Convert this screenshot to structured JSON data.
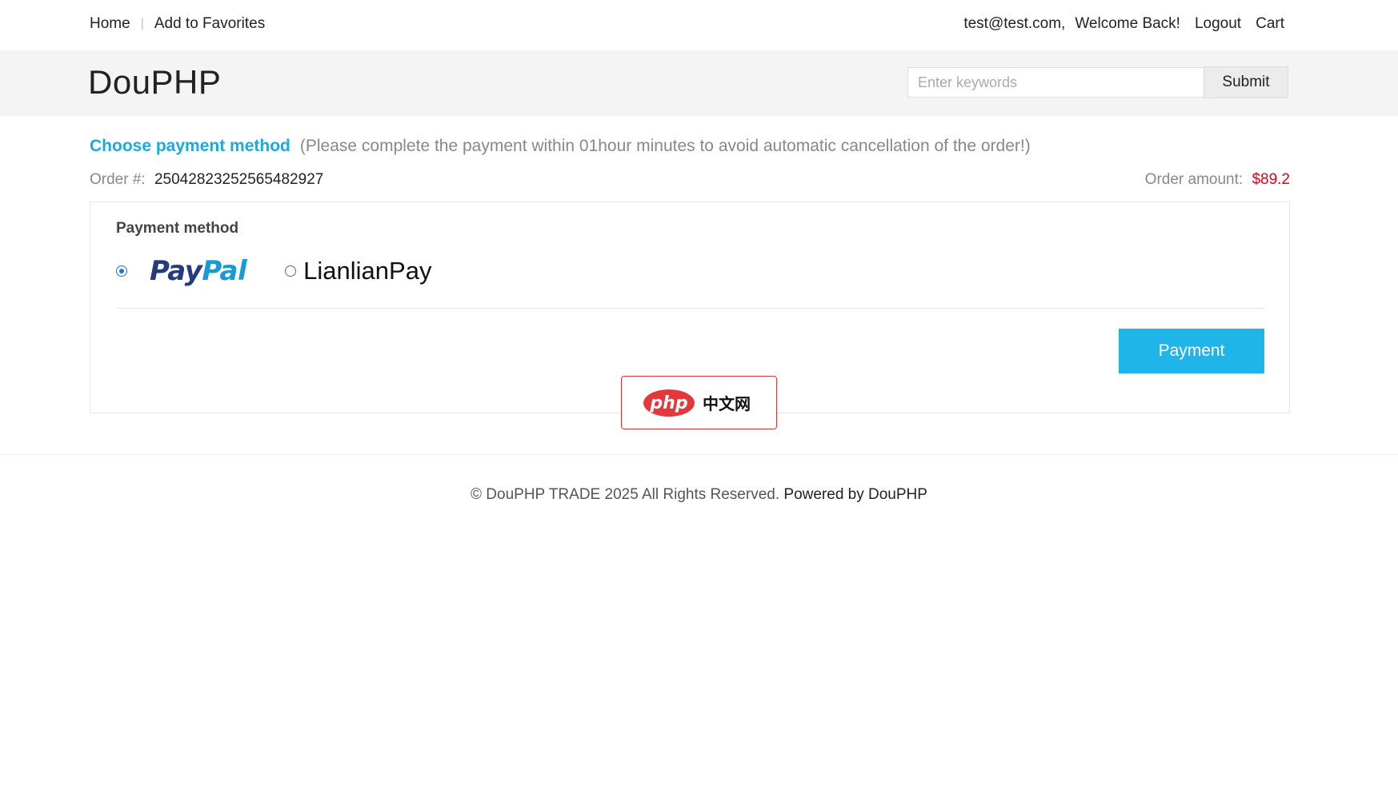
{
  "topnav": {
    "home": "Home",
    "favorites": "Add to Favorites",
    "user_email": "test@test.com,",
    "welcome": "Welcome Back!",
    "logout": "Logout",
    "cart": "Cart"
  },
  "header": {
    "logo": "DouPHP",
    "search_placeholder": "Enter keywords",
    "submit": "Submit"
  },
  "main": {
    "title": "Choose payment method",
    "note": "(Please complete the payment within 01hour minutes to avoid automatic cancellation of the order!)",
    "order_label": "Order #:",
    "order_number": "25042823252565482927",
    "amount_label": "Order amount:",
    "amount_value": "$89.2",
    "payment_method_title": "Payment method",
    "options": [
      {
        "label_part1": "Pay",
        "label_part2": "Pal",
        "selected": true
      },
      {
        "label": "LianlianPay",
        "selected": false
      }
    ],
    "payment_button": "Payment"
  },
  "watermark": {
    "text": "中文网",
    "logo_text": "php"
  },
  "footer": {
    "copyright": "© DouPHP TRADE 2025 All Rights Reserved.",
    "powered": "Powered by DouPHP"
  },
  "colors": {
    "accent": "#1aabde",
    "button": "#1fb5e8",
    "price": "#e60012"
  }
}
